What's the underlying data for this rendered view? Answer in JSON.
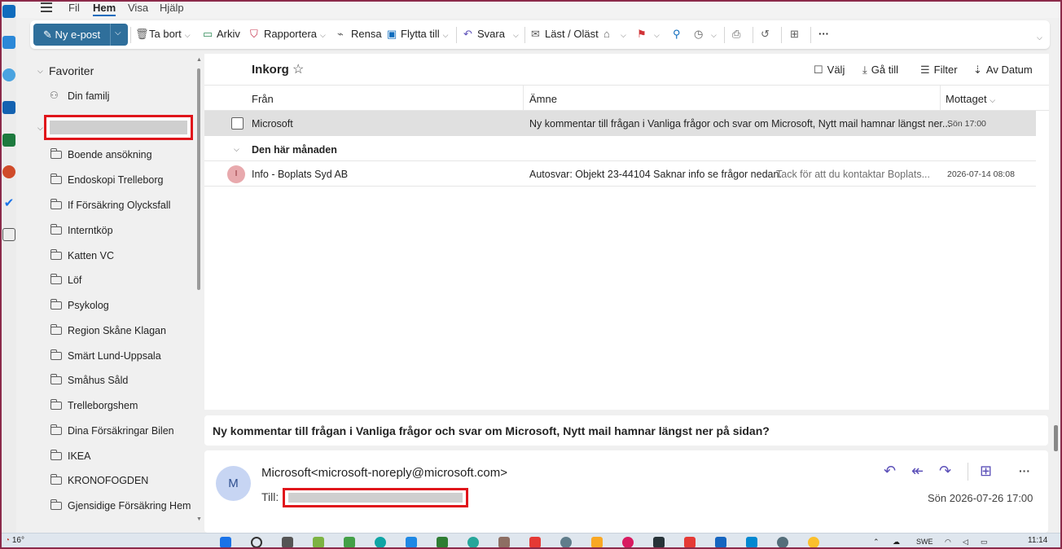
{
  "menu": {
    "items": [
      "Fil",
      "Hem",
      "Visa",
      "Hjälp"
    ],
    "active": "Hem"
  },
  "ribbon": {
    "new_mail": "Ny e-post",
    "delete": "Ta bort",
    "archive": "Arkiv",
    "report": "Rapportera",
    "sweep": "Rensa",
    "move_to": "Flytta till",
    "reply": "Svara",
    "read_unread": "Läst / Oläst"
  },
  "folders": {
    "favorites_label": "Favoriter",
    "items": [
      "Din familj",
      "Boende ansökning",
      "Endoskopi Trelleborg",
      "If Försäkring Olycksfall",
      "Interntköp",
      "Katten VC",
      "Löf",
      "Psykolog",
      "Region Skåne Klagan",
      "Smärt Lund-Uppsala",
      "Småhus Såld",
      "Trelleborgshem",
      "Dina Försäkringar Bilen",
      "IKEA",
      "KRONOFOGDEN",
      "Gjensidige Försäkring Hem"
    ]
  },
  "list": {
    "title": "Inkorg",
    "select": "Välj",
    "goto": "Gå till",
    "filter": "Filter",
    "sort": "Av Datum",
    "columns": {
      "from": "Från",
      "subject": "Ämne",
      "received": "Mottaget"
    },
    "group_label": "Den här månaden",
    "messages": [
      {
        "from": "Microsoft",
        "subject": "Ny kommentar till frågan i Vanliga frågor och svar om Microsoft, Nytt mail hamnar längst ner...",
        "preview": "",
        "date": "Sön 17:00"
      },
      {
        "initial": "I",
        "from": "Info - Boplats Syd AB",
        "subject": "Autosvar: Objekt 23-44104 Saknar info se frågor nedan.",
        "preview": "Tack för att du kontaktar Boplats...",
        "date": "2026-07-14 08:08"
      }
    ]
  },
  "reading": {
    "subject": "Ny kommentar till frågan i Vanliga frågor och svar om Microsoft, Nytt mail hamnar längst ner på sidan?",
    "avatar_initial": "M",
    "from": "Microsoft<microsoft-noreply@microsoft.com>",
    "to_label": "Till:",
    "date": "Sön 2026-07-26 17:00"
  },
  "taskbar": {
    "weather": "16°",
    "lang": "SWE",
    "time": "11:14"
  },
  "colors": {
    "accent": "#2f6f9b",
    "selection": "#e0e0e0",
    "redaction": "#e0151b",
    "flag": "#d13438",
    "pin": "#0f6cbd",
    "reply": "#5b4fb8"
  }
}
